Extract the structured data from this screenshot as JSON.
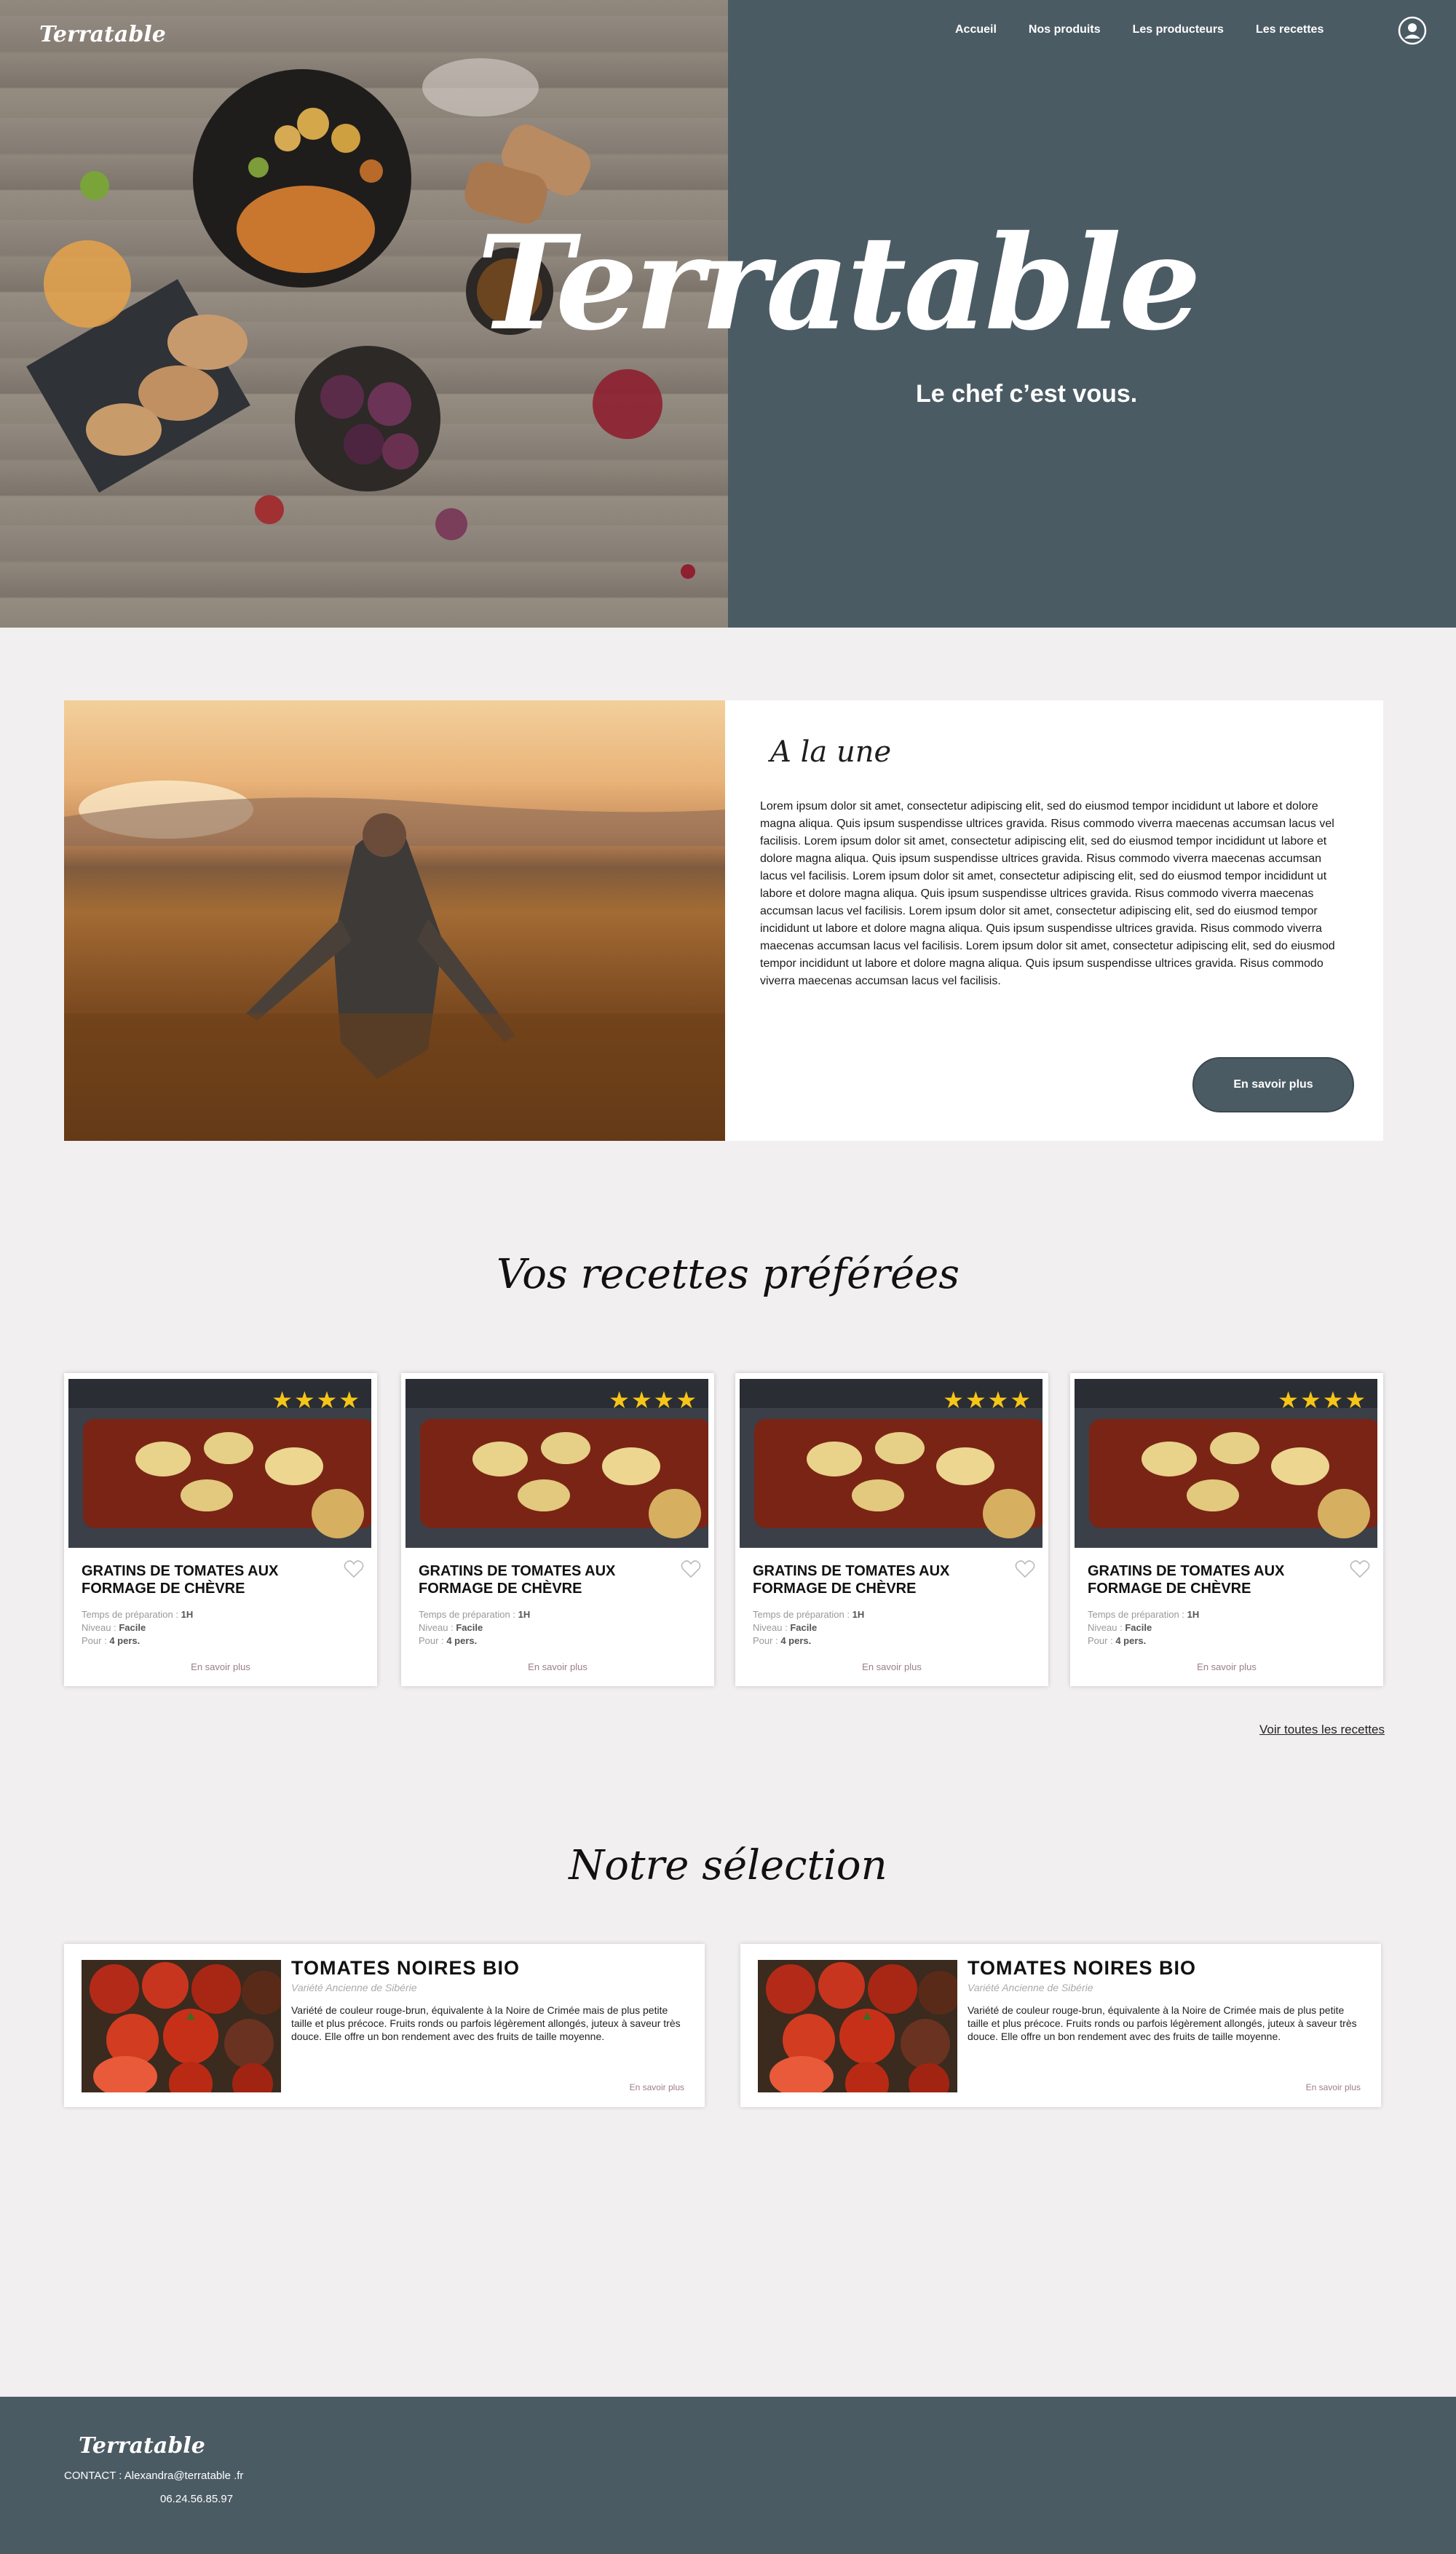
{
  "brand": {
    "logo": "Terratable"
  },
  "nav": {
    "items": [
      "Accueil",
      "Nos produits",
      "Les producteurs",
      "Les recettes"
    ]
  },
  "hero": {
    "title": "Terratable",
    "tagline": "Le chef c’est vous."
  },
  "feature": {
    "title": "A la une",
    "text": "Lorem ipsum dolor sit amet, consectetur adipiscing elit, sed do eiusmod tempor incididunt ut labore et dolore magna aliqua. Quis ipsum suspendisse ultrices gravida. Risus commodo viverra maecenas accumsan lacus vel facilisis. Lorem ipsum dolor sit amet, consectetur adipiscing elit, sed do eiusmod tempor incididunt ut labore et dolore magna aliqua. Quis ipsum suspendisse ultrices gravida. Risus commodo viverra maecenas accumsan lacus vel facilisis. Lorem ipsum dolor sit amet, consectetur adipiscing elit, sed do eiusmod tempor incididunt ut labore et dolore magna aliqua. Quis ipsum suspendisse ultrices gravida. Risus commodo viverra maecenas accumsan lacus vel facilisis. Lorem ipsum dolor sit amet, consectetur adipiscing elit, sed do eiusmod tempor incididunt ut labore et dolore magna aliqua. Quis ipsum suspendisse ultrices gravida. Risus commodo viverra maecenas accumsan lacus vel facilisis. Lorem ipsum dolor sit amet, consectetur adipiscing elit, sed do eiusmod tempor incididunt ut labore et dolore magna aliqua. Quis ipsum suspendisse ultrices gravida. Risus commodo viverra maecenas accumsan lacus vel facilisis.",
    "button": "En savoir plus"
  },
  "recipes": {
    "title": "Vos recettes préférées",
    "see_all": "Voir toutes les recettes",
    "cards": [
      {
        "rating": 4,
        "name": "GRATINS DE TOMATES AUX FORMAGE DE CHÈVRE",
        "prep_label": "Temps de préparation :",
        "prep": "1H",
        "level_label": "Niveau :",
        "level": "Facile",
        "for_label": "Pour :",
        "for": "4 pers.",
        "link": "En savoir plus"
      },
      {
        "rating": 4,
        "name": "GRATINS DE TOMATES AUX FORMAGE DE CHÈVRE",
        "prep_label": "Temps de préparation :",
        "prep": "1H",
        "level_label": "Niveau :",
        "level": "Facile",
        "for_label": "Pour :",
        "for": "4 pers.",
        "link": "En savoir plus"
      },
      {
        "rating": 4,
        "name": "GRATINS DE TOMATES AUX FORMAGE DE CHÈVRE",
        "prep_label": "Temps de préparation :",
        "prep": "1H",
        "level_label": "Niveau :",
        "level": "Facile",
        "for_label": "Pour :",
        "for": "4 pers.",
        "link": "En savoir plus"
      },
      {
        "rating": 4,
        "name": "GRATINS DE TOMATES AUX FORMAGE DE CHÈVRE",
        "prep_label": "Temps de préparation :",
        "prep": "1H",
        "level_label": "Niveau :",
        "level": "Facile",
        "for_label": "Pour :",
        "for": "4 pers.",
        "link": "En savoir plus"
      }
    ]
  },
  "selection": {
    "title": "Notre sélection",
    "cards": [
      {
        "name": "TOMATES NOIRES BIO",
        "subtitle": "Variété Ancienne de Sibérie",
        "description": "Variété de couleur rouge-brun, équivalente à la Noire de Crimée mais de plus petite taille et plus précoce. Fruits ronds ou parfois légèrement allongés, juteux à saveur très douce. Elle offre un bon rendement avec des fruits de taille moyenne.",
        "link": "En savoir plus"
      },
      {
        "name": "TOMATES NOIRES BIO",
        "subtitle": "Variété Ancienne de Sibérie",
        "description": "Variété de couleur rouge-brun, équivalente à la Noire de Crimée mais de plus petite taille et plus précoce. Fruits ronds ou parfois légèrement allongés, juteux à saveur très douce. Elle offre un bon rendement avec des fruits de taille moyenne.",
        "link": "En savoir plus"
      }
    ]
  },
  "footer": {
    "logo": "Terratable",
    "contact": "CONTACT : Alexandra@terratable .fr",
    "phone": "06.24.56.85.97"
  },
  "colors": {
    "slate": "#4b5b64",
    "background": "#f1eff0",
    "star": "#f5c518",
    "link": "#9c7d88"
  }
}
